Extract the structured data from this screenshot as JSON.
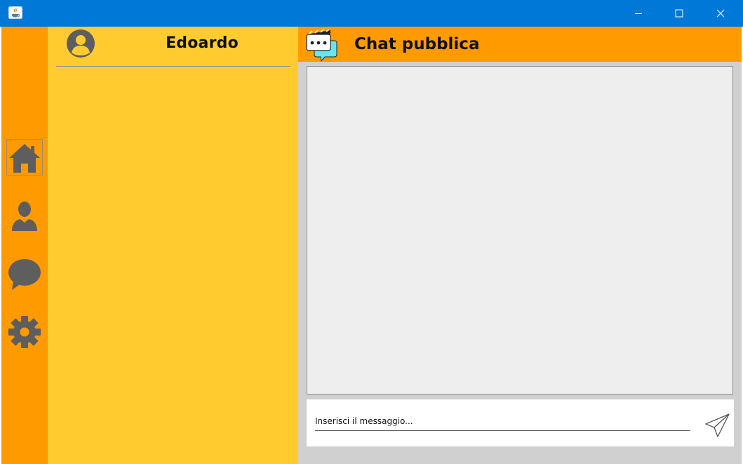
{
  "window": {
    "icon": "java-cup-icon",
    "controls": {
      "minimize": "minimize-icon",
      "maximize": "maximize-icon",
      "close": "close-icon"
    },
    "titlebar_color": "#0078d7"
  },
  "nav": {
    "items": [
      {
        "icon": "home-icon",
        "selected": true
      },
      {
        "icon": "user-icon",
        "selected": false
      },
      {
        "icon": "chat-bubble-icon",
        "selected": false
      },
      {
        "icon": "gear-icon",
        "selected": false
      }
    ],
    "background": "#ff9b00"
  },
  "user_panel": {
    "name": "Edoardo",
    "avatar_icon": "user-avatar-icon",
    "background": "#ffcb2f"
  },
  "chat": {
    "title": "Chat pubblica",
    "logo_icon": "clapperboard-chat-icon",
    "header_color": "#ff9b00",
    "input_placeholder": "Inserisci il messaggio...",
    "input_value": "",
    "send_icon": "paper-plane-icon"
  }
}
